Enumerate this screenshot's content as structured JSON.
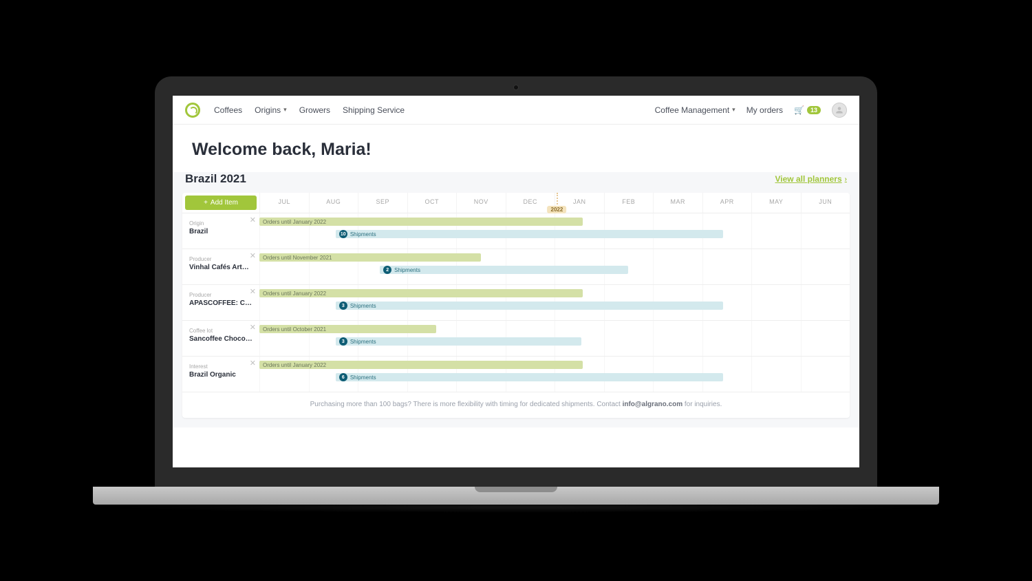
{
  "nav": {
    "links": {
      "coffees": "Coffees",
      "origins": "Origins",
      "growers": "Growers",
      "shipping": "Shipping Service"
    },
    "right": {
      "management": "Coffee Management",
      "orders": "My orders",
      "cart_count": "13"
    }
  },
  "hero": {
    "title": "Welcome back, Maria!"
  },
  "planner": {
    "title": "Brazil 2021",
    "view_all": "View all planners",
    "add_item": "Add Item",
    "months": [
      "JUL",
      "AUG",
      "SEP",
      "OCT",
      "NOV",
      "DEC",
      "JAN",
      "FEB",
      "MAR",
      "APR",
      "MAY",
      "JUN"
    ],
    "year_label": "2022",
    "rows": [
      {
        "cat": "Origin",
        "name": "Brazil",
        "orders_label": "Orders until January 2022",
        "orders_end": 6.58,
        "ship_count": "10",
        "ship_label": "Shipments",
        "ship_start": 1.55,
        "ship_end": 9.42
      },
      {
        "cat": "Producer",
        "name": "Vinhal Cafés Artesan…",
        "orders_label": "Orders until November 2021",
        "orders_end": 4.5,
        "ship_count": "2",
        "ship_label": "Shipments",
        "ship_start": 2.45,
        "ship_end": 7.5
      },
      {
        "cat": "Producer",
        "name": "APASCOFFEE: COOPER…",
        "orders_label": "Orders until January 2022",
        "orders_end": 6.58,
        "ship_count": "3",
        "ship_label": "Shipments",
        "ship_start": 1.55,
        "ship_end": 9.42
      },
      {
        "cat": "Coffee lot",
        "name": "Sancoffee Chocolate …",
        "orders_label": "Orders until October 2021",
        "orders_end": 3.6,
        "ship_count": "3",
        "ship_label": "Shipments",
        "ship_start": 1.55,
        "ship_end": 6.55
      },
      {
        "cat": "Interest",
        "name": "Brazil Organic",
        "orders_label": "Orders until January 2022",
        "orders_end": 6.58,
        "ship_count": "6",
        "ship_label": "Shipments",
        "ship_start": 1.55,
        "ship_end": 9.42
      }
    ],
    "footnote": {
      "pre": "Purchasing more than 100 bags? There is more flexibility with timing for dedicated shipments. Contact ",
      "email": "info@algrano.com",
      "post": " for inquiries."
    }
  },
  "chart_data": {
    "type": "gantt-like",
    "x_categories": [
      "JUL 2021",
      "AUG 2021",
      "SEP 2021",
      "OCT 2021",
      "NOV 2021",
      "DEC 2021",
      "JAN 2022",
      "FEB 2022",
      "MAR 2022",
      "APR 2022",
      "MAY 2022",
      "JUN 2022"
    ],
    "series": [
      {
        "name": "Brazil (Origin) — Orders",
        "start_month": 0,
        "end_month": 6.58
      },
      {
        "name": "Brazil (Origin) — Shipments",
        "start_month": 1.55,
        "end_month": 9.42,
        "count": 10
      },
      {
        "name": "Vinhal Cafés — Orders",
        "start_month": 0,
        "end_month": 4.5
      },
      {
        "name": "Vinhal Cafés — Shipments",
        "start_month": 2.45,
        "end_month": 7.5,
        "count": 2
      },
      {
        "name": "APASCOFFEE — Orders",
        "start_month": 0,
        "end_month": 6.58
      },
      {
        "name": "APASCOFFEE — Shipments",
        "start_month": 1.55,
        "end_month": 9.42,
        "count": 3
      },
      {
        "name": "Sancoffee Chocolate — Orders",
        "start_month": 0,
        "end_month": 3.6
      },
      {
        "name": "Sancoffee Chocolate — Shipments",
        "start_month": 1.55,
        "end_month": 6.55,
        "count": 3
      },
      {
        "name": "Brazil Organic — Orders",
        "start_month": 0,
        "end_month": 6.58
      },
      {
        "name": "Brazil Organic — Shipments",
        "start_month": 1.55,
        "end_month": 9.42,
        "count": 6
      }
    ],
    "year_boundary_after_index": 5
  }
}
